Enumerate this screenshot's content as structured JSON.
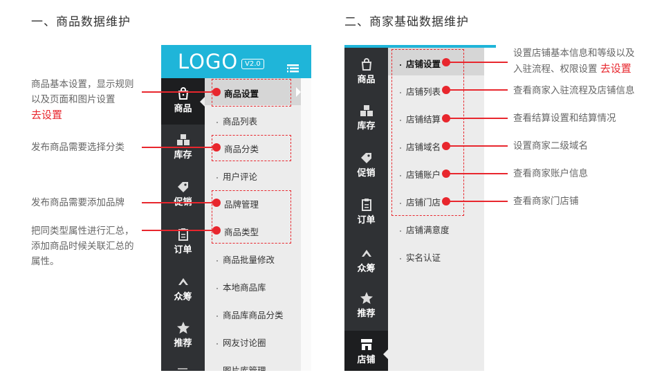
{
  "section1": {
    "title": "一、商品数据维护",
    "logo": "LOGO",
    "version": "V2.0",
    "nav": [
      {
        "label": "商品",
        "icon": "bag-icon"
      },
      {
        "label": "库存",
        "icon": "boxes-icon"
      },
      {
        "label": "促销",
        "icon": "tag-icon"
      },
      {
        "label": "订单",
        "icon": "clipboard-icon"
      },
      {
        "label": "众筹",
        "icon": "crowdfund-icon"
      },
      {
        "label": "推荐",
        "icon": "star-icon"
      }
    ],
    "submenu": [
      "商品设置",
      "商品列表",
      "商品分类",
      "用户评论",
      "品牌管理",
      "商品类型",
      "商品批量修改",
      "本地商品库",
      "商品库商品分类",
      "网友讨论圈",
      "图片库管理"
    ],
    "notes": {
      "n1_line1": "商品基本设置，显示规则",
      "n1_line2": "以及页面和图片设置",
      "n1_link": "去设置",
      "n2": "发布商品需要选择分类",
      "n3": "发布商品需要添加品牌",
      "n4_line1": "把同类型属性进行汇总，",
      "n4_line2": "添加商品时候关联汇总的",
      "n4_line3": "属性。"
    }
  },
  "section2": {
    "title": "二、商家基础数据维护",
    "nav": [
      {
        "label": "商品",
        "icon": "bag-icon"
      },
      {
        "label": "库存",
        "icon": "boxes-icon"
      },
      {
        "label": "促销",
        "icon": "tag-icon"
      },
      {
        "label": "订单",
        "icon": "clipboard-icon"
      },
      {
        "label": "众筹",
        "icon": "crowdfund-icon"
      },
      {
        "label": "推荐",
        "icon": "star-icon"
      },
      {
        "label": "店铺",
        "icon": "store-icon"
      }
    ],
    "submenu": [
      "店铺设置",
      "店铺列表",
      "店铺结算",
      "店铺域名",
      "店铺账户",
      "店铺门店",
      "店铺满意度",
      "实名认证"
    ],
    "notes": {
      "n1_line1": "设置店铺基本信息和等级以及",
      "n1_line2": "入驻流程、权限设置",
      "n1_link": "去设置",
      "n2": "查看商家入驻流程及店铺信息",
      "n3": "查看结算设置和结算情况",
      "n4": "设置商家二级域名",
      "n5": "查看商家账户信息",
      "n6": "查看商家门店铺"
    }
  },
  "colors": {
    "accent": "#1fb5d9",
    "annotation": "#e8262d",
    "nav_dark": "#2f3134"
  }
}
